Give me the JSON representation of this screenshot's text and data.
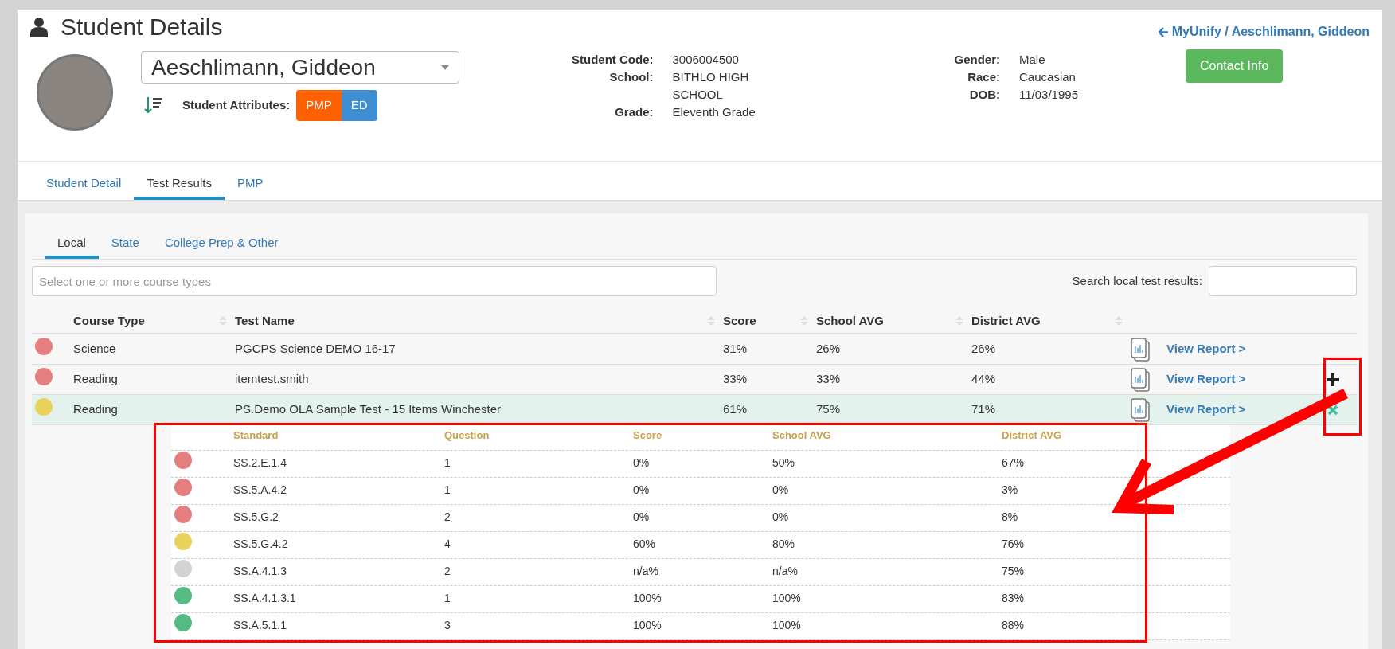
{
  "page": {
    "title": "Student Details"
  },
  "breadcrumb": {
    "text": "MyUnify / Aeschlimann, Giddeon"
  },
  "student": {
    "name": "Aeschlimann, Giddeon",
    "attributes_label": "Student Attributes:",
    "attributes": [
      {
        "label": "PMP",
        "color": "#ff6000"
      },
      {
        "label": "ED",
        "color": "#3d8fd1"
      }
    ]
  },
  "details_left": [
    {
      "label": "Student Code:",
      "value": "3006004500"
    },
    {
      "label": "School:",
      "value": "BITHLO HIGH SCHOOL"
    },
    {
      "label": "Grade:",
      "value": "Eleventh Grade"
    }
  ],
  "details_right": [
    {
      "label": "Gender:",
      "value": "Male"
    },
    {
      "label": "Race:",
      "value": "Caucasian"
    },
    {
      "label": "DOB:",
      "value": "11/03/1995"
    }
  ],
  "contact_button": "Contact Info",
  "tabs": [
    {
      "label": "Student Detail",
      "selected": false
    },
    {
      "label": "Test Results",
      "selected": true
    },
    {
      "label": "PMP",
      "selected": false
    }
  ],
  "subtabs": [
    {
      "label": "Local",
      "selected": true
    },
    {
      "label": "State",
      "selected": false
    },
    {
      "label": "College Prep & Other",
      "selected": false
    }
  ],
  "filter": {
    "placeholder": "Select one or more course types"
  },
  "search": {
    "label": "Search local test results:"
  },
  "results": {
    "columns": [
      "Course Type",
      "Test Name",
      "Score",
      "School AVG",
      "District AVG"
    ],
    "rows": [
      {
        "course_type": "Science",
        "test_name": "PGCPS Science DEMO 16-17",
        "score": "31%",
        "school_avg": "26%",
        "district_avg": "26%",
        "color": "#e57f7f",
        "link": "View Report >",
        "expanded": false,
        "hovered": false
      },
      {
        "course_type": "Reading",
        "test_name": "itemtest.smith",
        "score": "33%",
        "school_avg": "33%",
        "district_avg": "44%",
        "color": "#e57f7f",
        "link": "View Report >",
        "expanded": false,
        "hovered": true
      },
      {
        "course_type": "Reading",
        "test_name": "PS.Demo OLA Sample Test - 15 Items Winchester",
        "score": "61%",
        "school_avg": "75%",
        "district_avg": "71%",
        "color": "#e8d25c",
        "link": "View Report >",
        "expanded": true
      }
    ]
  },
  "standards": {
    "columns": [
      "Standard",
      "Question",
      "Score",
      "School AVG",
      "District AVG"
    ],
    "rows": [
      {
        "standard": "SS.2.E.1.4",
        "question": "1",
        "score": "0%",
        "school_avg": "50%",
        "district_avg": "67%",
        "color": "#e57f7f"
      },
      {
        "standard": "SS.5.A.4.2",
        "question": "1",
        "score": "0%",
        "school_avg": "0%",
        "district_avg": "3%",
        "color": "#e57f7f"
      },
      {
        "standard": "SS.5.G.2",
        "question": "2",
        "score": "0%",
        "school_avg": "0%",
        "district_avg": "8%",
        "color": "#e57f7f"
      },
      {
        "standard": "SS.5.G.4.2",
        "question": "4",
        "score": "60%",
        "school_avg": "80%",
        "district_avg": "76%",
        "color": "#e8d25c"
      },
      {
        "standard": "SS.A.4.1.3",
        "question": "2",
        "score": "n/a%",
        "school_avg": "n/a%",
        "district_avg": "75%",
        "color": "#d3d3d3"
      },
      {
        "standard": "SS.A.4.1.3.1",
        "question": "1",
        "score": "100%",
        "school_avg": "100%",
        "district_avg": "83%",
        "color": "#55bb85"
      },
      {
        "standard": "SS.A.5.1.1",
        "question": "3",
        "score": "100%",
        "school_avg": "100%",
        "district_avg": "88%",
        "color": "#55bb85"
      }
    ]
  }
}
